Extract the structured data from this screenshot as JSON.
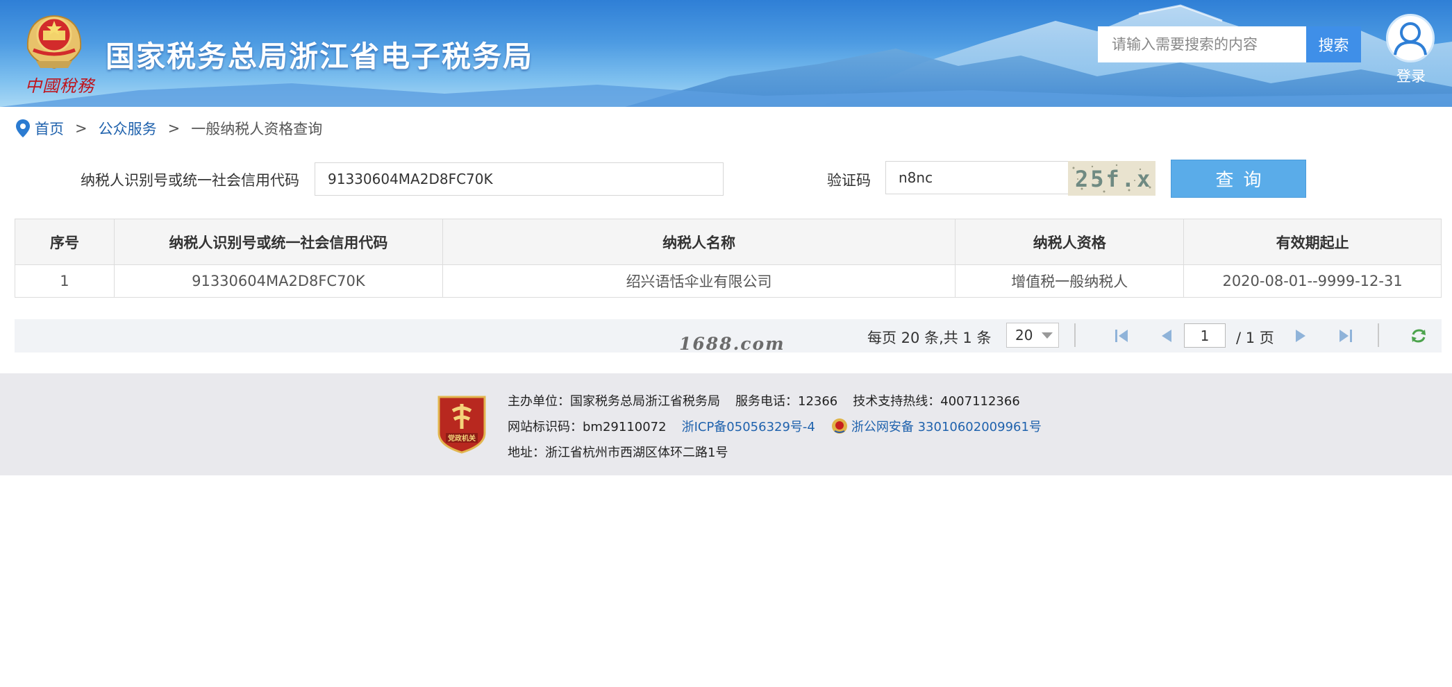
{
  "header": {
    "emblem_script": "中國稅務",
    "title": "国家税务总局浙江省电子税务局",
    "search_placeholder": "请输入需要搜索的内容",
    "search_button": "搜索",
    "login_label": "登录"
  },
  "breadcrumb": {
    "home": "首页",
    "separator": ">",
    "section": "公众服务",
    "current": "一般纳税人资格查询"
  },
  "form": {
    "taxpayer_id_label": "纳税人识别号或统一社会信用代码",
    "taxpayer_id_value": "91330604MA2D8FC70K",
    "captcha_label": "验证码",
    "captcha_value": "n8nc",
    "captcha_image_text": "25f.x",
    "query_button": "查询"
  },
  "table": {
    "headers": [
      "序号",
      "纳税人识别号或统一社会信用代码",
      "纳税人名称",
      "纳税人资格",
      "有效期起止"
    ],
    "rows": [
      [
        "1",
        "91330604MA2D8FC70K",
        "绍兴语恬伞业有限公司",
        "增值税一般纳税人",
        "2020-08-01--9999-12-31"
      ]
    ]
  },
  "pager": {
    "summary": "每页 20 条,共 1 条",
    "page_size": "20",
    "current_page": "1",
    "total_pages": "/ 1 页"
  },
  "watermark": "1688.com",
  "footer": {
    "line1_host": "主办单位：国家税务总局浙江省税务局",
    "line1_phone": "服务电话：12366",
    "line1_hotline": "技术支持热线：4007112366",
    "line2_site_id": "网站标识码：bm29110072",
    "line2_icp": "浙ICP备05056329号-4",
    "line2_police": "浙公网安备 33010602009961号",
    "line3_address": "地址：浙江省杭州市西湖区体环二路1号",
    "badge_text": "党政机关"
  },
  "colors": {
    "link": "#1f62ad",
    "query_button": "#5aace9",
    "search_button": "#3f8fe8",
    "emblem_red": "#c0141c"
  }
}
